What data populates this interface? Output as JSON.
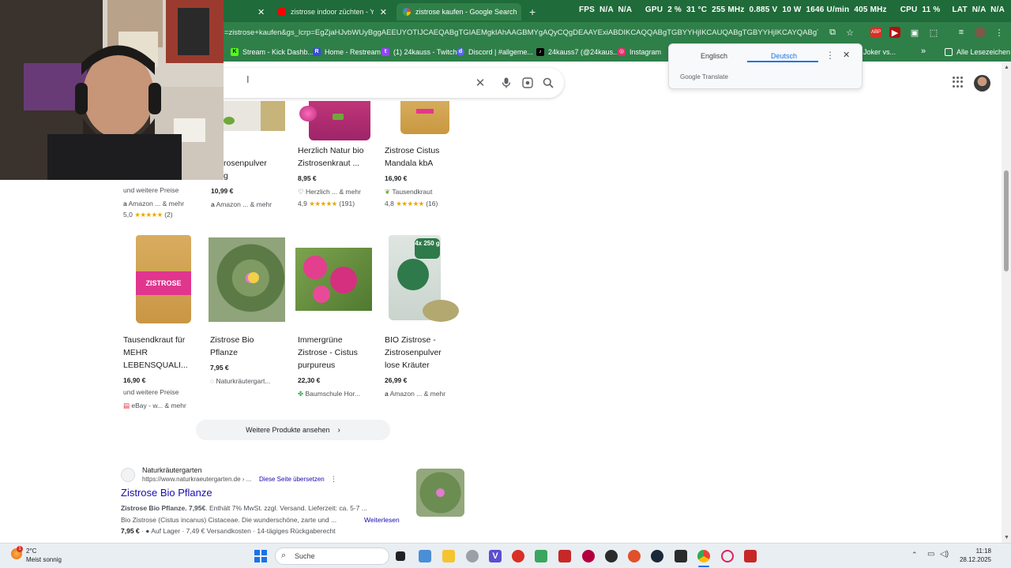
{
  "browser": {
    "tabs": [
      {
        "label": "",
        "active": false
      },
      {
        "label": "zistrose indoor züchten - YouT",
        "active": false
      },
      {
        "label": "zistrose kaufen - Google Search",
        "active": true
      }
    ],
    "new_tab_label": "+",
    "hud": [
      "FPS",
      "N/A",
      "N/A",
      "GPU",
      "2 %",
      "31 °C",
      "255 MHz",
      "0.885 V",
      "10 W",
      "1646 U/min",
      "405 MHz",
      "CPU",
      "11 %",
      "LAT",
      "N/A",
      "N/A"
    ],
    "url": "=zistrose+kaufen&gs_lcrp=EgZjaHJvbWUyBggAEEUYOTIJCAEQABgTGIAEMgkIAhAAGBMYgAQyCQgDEAAYExiABDIKCAQQABgTGBYYHjIKCAUQABgTGBYYHjIKCAYQABgTGBYYHjIKCAc...",
    "bookmarks": [
      "Stream - Kick Dashb...",
      "Home - Restream",
      "(1) 24kauss - Twitch",
      "Discord | #allgeme...",
      "24kauss7 (@24kaus...",
      "Instagram",
      "Joker vs...",
      "»",
      "Alle Lesezeichen"
    ]
  },
  "translate_popup": {
    "lang_source": "Englisch",
    "lang_target": "Deutsch",
    "brand": "Google Translate",
    "menu_icon": "more-vert-icon",
    "close_icon": "close-icon"
  },
  "search": {
    "query": "",
    "icons": [
      "clear-icon",
      "mic-icon",
      "lens-icon",
      "search-icon"
    ]
  },
  "products_row1": [
    {
      "title_line1": "",
      "title_line2": "",
      "price": "",
      "store": "und weitere Preise",
      "seller": "Amazon ... & mehr",
      "rating": "5,0",
      "stars": "★★★★★",
      "reviews": "(2)"
    },
    {
      "title_line1": "rosenpulver",
      "title_line2": "g",
      "price": "10,99 €",
      "store": "",
      "seller": "Amazon ... & mehr",
      "rating": "",
      "stars": "",
      "reviews": ""
    },
    {
      "title_line1": "Herzlich Natur bio",
      "title_line2": "Zistrosenkraut ...",
      "price": "8,95 €",
      "store": "",
      "seller": "Herzlich ... & mehr",
      "rating": "4,9",
      "stars": "★★★★★",
      "reviews": "(191)"
    },
    {
      "title_line1": "Zistrose Cistus",
      "title_line2": "Mandala kbA",
      "price": "16,90 €",
      "store": "",
      "seller": "Tausendkraut",
      "rating": "4,8",
      "stars": "★★★★★",
      "reviews": "(16)"
    }
  ],
  "products_row2": [
    {
      "lines": [
        "Tausendkraut für",
        "MEHR",
        "LEBENSQUALI..."
      ],
      "price": "16,90 €",
      "extra": "und weitere Preise",
      "seller": "eBay - w... & mehr",
      "pouch_label": "ZISTROSE"
    },
    {
      "lines": [
        "Zistrose Bio",
        "Pflanze"
      ],
      "price": "7,95 €",
      "extra": "",
      "seller": "Naturkräutergart..."
    },
    {
      "lines": [
        "Immergrüne",
        "Zistrose - Cistus",
        "purpureus"
      ],
      "price": "22,30 €",
      "extra": "",
      "seller": "Baumschule Hor..."
    },
    {
      "lines": [
        "BIO Zistrose -",
        "Zistrosenpulver",
        "lose Kräuter"
      ],
      "price": "26,99 €",
      "extra": "",
      "seller": "Amazon ... & mehr",
      "badge": "4x 250 g"
    }
  ],
  "more_products": "Weitere Produkte ansehen",
  "result": {
    "site": "Naturkräutergarten",
    "url": "https://www.naturkraeutergarten.de › ...",
    "translate": "Diese Seite übersetzen",
    "title": "Zistrose Bio Pflanze",
    "snippet1_bold": "Zistrose Bio Pflanze. 7,95€",
    "snippet1_rest": ". Enthält 7% MwSt. zzgl. Versand. Lieferzeit: ca. 5-7 ...",
    "snippet2": "Bio Zistrose (Cistus incanus) Cistaceae. Die wunderschöne, zarte und ...",
    "read_more": "Weiterlesen",
    "snippet3_price": "7,95 €",
    "snippet3_rest": "·  ● Auf Lager · 7,49 € Versandkosten · 14-tägiges Rückgaberecht"
  },
  "taskbar": {
    "weather_temp": "2°C",
    "weather_status": "Meist sonnig",
    "search_label": "Suche",
    "time": "11:18",
    "date": "28.12.2025"
  },
  "colors": {
    "chrome_green": "#2f7f49",
    "link_blue": "#1a0dab",
    "star": "#e7a900"
  }
}
